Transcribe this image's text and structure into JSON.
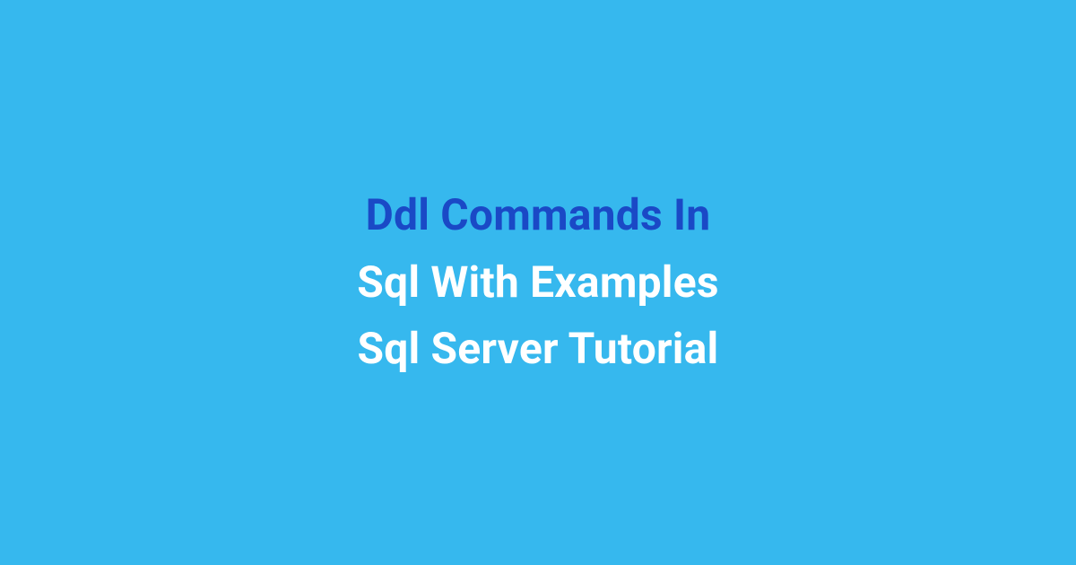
{
  "banner": {
    "line1": "Ddl Commands In",
    "line2": "Sql With Examples",
    "line3": "Sql Server Tutorial"
  }
}
